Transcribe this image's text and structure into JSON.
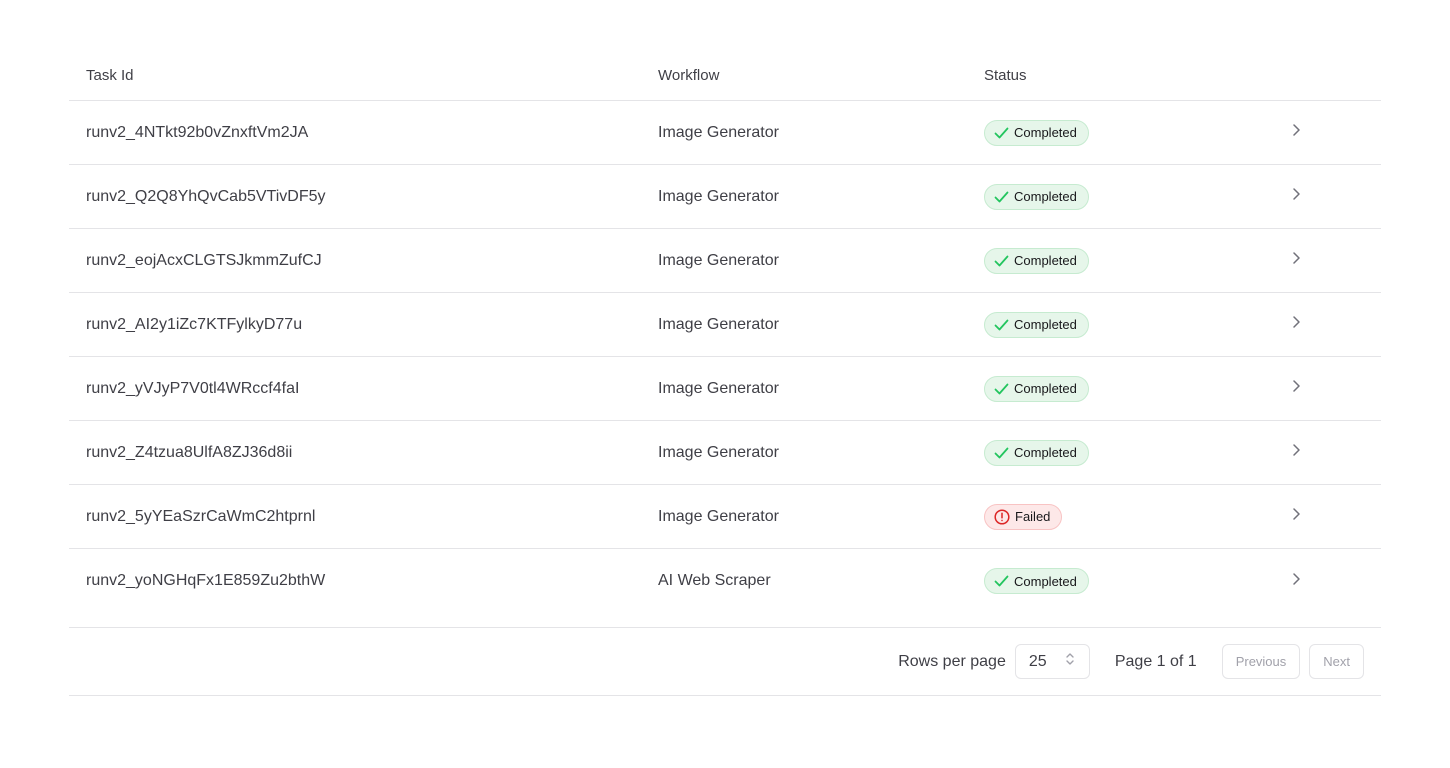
{
  "table": {
    "headers": {
      "task_id": "Task Id",
      "workflow": "Workflow",
      "status": "Status"
    },
    "rows": [
      {
        "task_id": "runv2_4NTkt92b0vZnxftVm2JA",
        "workflow": "Image Generator",
        "status": "Completed",
        "status_kind": "success"
      },
      {
        "task_id": "runv2_Q2Q8YhQvCab5VTivDF5y",
        "workflow": "Image Generator",
        "status": "Completed",
        "status_kind": "success"
      },
      {
        "task_id": "runv2_eojAcxCLGTSJkmmZufCJ",
        "workflow": "Image Generator",
        "status": "Completed",
        "status_kind": "success"
      },
      {
        "task_id": "runv2_AI2y1iZc7KTFylkyD77u",
        "workflow": "Image Generator",
        "status": "Completed",
        "status_kind": "success"
      },
      {
        "task_id": "runv2_yVJyP7V0tl4WRccf4faI",
        "workflow": "Image Generator",
        "status": "Completed",
        "status_kind": "success"
      },
      {
        "task_id": "runv2_Z4tzua8UlfA8ZJ36d8ii",
        "workflow": "Image Generator",
        "status": "Completed",
        "status_kind": "success"
      },
      {
        "task_id": "runv2_5yYEaSzrCaWmC2htprnl",
        "workflow": "Image Generator",
        "status": "Failed",
        "status_kind": "error"
      },
      {
        "task_id": "runv2_yoNGHqFx1E859Zu2bthW",
        "workflow": "AI Web Scraper",
        "status": "Completed",
        "status_kind": "success"
      }
    ]
  },
  "pagination": {
    "rows_per_page_label": "Rows per page",
    "rows_per_page_value": "25",
    "page_info": "Page 1 of 1",
    "previous_label": "Previous",
    "next_label": "Next"
  },
  "icons": {
    "success": "check-icon",
    "error": "alert-circle-icon",
    "row_action": "chevron-right-icon",
    "select": "chevron-up-down-icon"
  },
  "colors": {
    "success_icon": "#22c55e",
    "success_bg": "#e6f6ea",
    "error_icon": "#dc2626",
    "error_bg": "#fde8e8",
    "border": "#e4e4e7"
  }
}
